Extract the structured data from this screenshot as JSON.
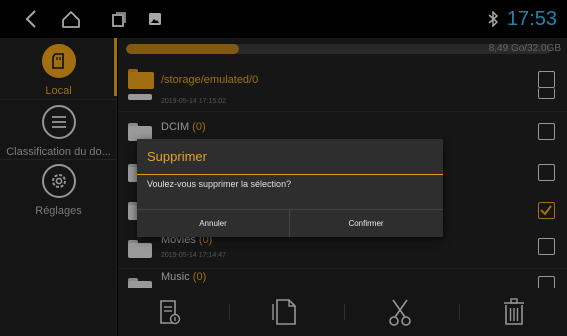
{
  "status_bar": {
    "time": "17:53",
    "icons": [
      "back-icon",
      "home-icon",
      "recent-apps-icon",
      "gallery-notification-icon",
      "bluetooth-icon"
    ]
  },
  "sidebar": {
    "items": [
      {
        "label": "Local",
        "icon": "sd-card-icon",
        "active": true
      },
      {
        "label": "Classification du do...",
        "icon": "list-icon",
        "active": false
      },
      {
        "label": "Réglages",
        "icon": "settings-gear-icon",
        "active": false
      }
    ]
  },
  "storage": {
    "usage_text": "8,49 Go/32.0GB",
    "used_fraction": 0.265
  },
  "file_list": {
    "path": "/storage/emulated/0",
    "rows": [
      {
        "name": "",
        "count": "",
        "date": "2019-05-14 17:15:02",
        "checked": false
      },
      {
        "name": "DCIM",
        "count": "(0)",
        "date": "",
        "checked": false
      },
      {
        "name": "",
        "count": "",
        "date": "",
        "checked": false
      },
      {
        "name": "",
        "count": "",
        "date": "",
        "checked": true
      },
      {
        "name": "Movies",
        "count": "(0)",
        "date": "2019-05-14 17:14:47",
        "checked": false
      },
      {
        "name": "Music",
        "count": "(0)",
        "date": "",
        "checked": false
      }
    ]
  },
  "toolbar": {
    "buttons": [
      "details-icon",
      "copy-icon",
      "cut-icon",
      "delete-icon"
    ]
  },
  "dialog": {
    "title": "Supprimer",
    "message": "Voulez-vous supprimer la sélection?",
    "cancel_label": "Annuler",
    "confirm_label": "Confirmer"
  },
  "colors": {
    "accent": "#e09a1a",
    "time": "#2fb8f0",
    "background": "#1f1f1f"
  }
}
